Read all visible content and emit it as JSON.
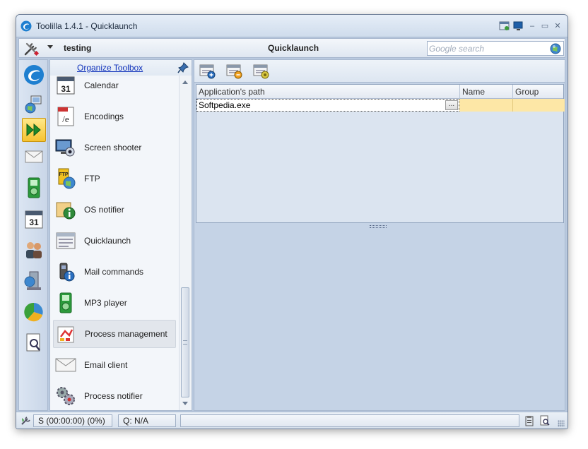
{
  "window": {
    "title": "Toolilla 1.4.1 - Quicklaunch"
  },
  "toolbar": {
    "profile": "testing",
    "section_title": "Quicklaunch",
    "search_placeholder": "Google search"
  },
  "iconbar": {
    "items": [
      {
        "icon": "toolilla-logo-icon"
      },
      {
        "icon": "network-monitor-icon"
      },
      {
        "icon": "quicklaunch-arrows-icon",
        "active": true
      },
      {
        "icon": "envelope-icon"
      },
      {
        "icon": "mp3-player-icon"
      },
      {
        "icon": "calendar-icon"
      },
      {
        "icon": "users-icon"
      },
      {
        "icon": "computer-ftp-icon"
      },
      {
        "icon": "pie-chart-icon"
      },
      {
        "icon": "document-search-icon"
      }
    ]
  },
  "toolbox": {
    "organize_label": "Organize Toolbox",
    "items": [
      {
        "label": "Calendar",
        "icon": "calendar-icon"
      },
      {
        "label": "Encodings",
        "icon": "encodings-icon"
      },
      {
        "label": "Screen shooter",
        "icon": "screen-shooter-icon"
      },
      {
        "label": "FTP",
        "icon": "ftp-icon"
      },
      {
        "label": "OS notifier",
        "icon": "os-notifier-icon"
      },
      {
        "label": "Quicklaunch",
        "icon": "quicklaunch-icon"
      },
      {
        "label": "Mail commands",
        "icon": "mail-commands-icon"
      },
      {
        "label": "MP3 player",
        "icon": "mp3-player-icon"
      },
      {
        "label": "Process management",
        "icon": "process-management-icon",
        "hover": true
      },
      {
        "label": "Email client",
        "icon": "email-client-icon"
      },
      {
        "label": "Process notifier",
        "icon": "process-notifier-icon"
      }
    ]
  },
  "grid": {
    "columns": [
      "Application's path",
      "Name",
      "Group"
    ],
    "rows": [
      {
        "path": "Softpedia.exe",
        "name": "",
        "group": ""
      }
    ],
    "ellipsis_label": "..."
  },
  "status": {
    "session": "S (00:00:00) (0%)",
    "queue": "Q: N/A"
  }
}
